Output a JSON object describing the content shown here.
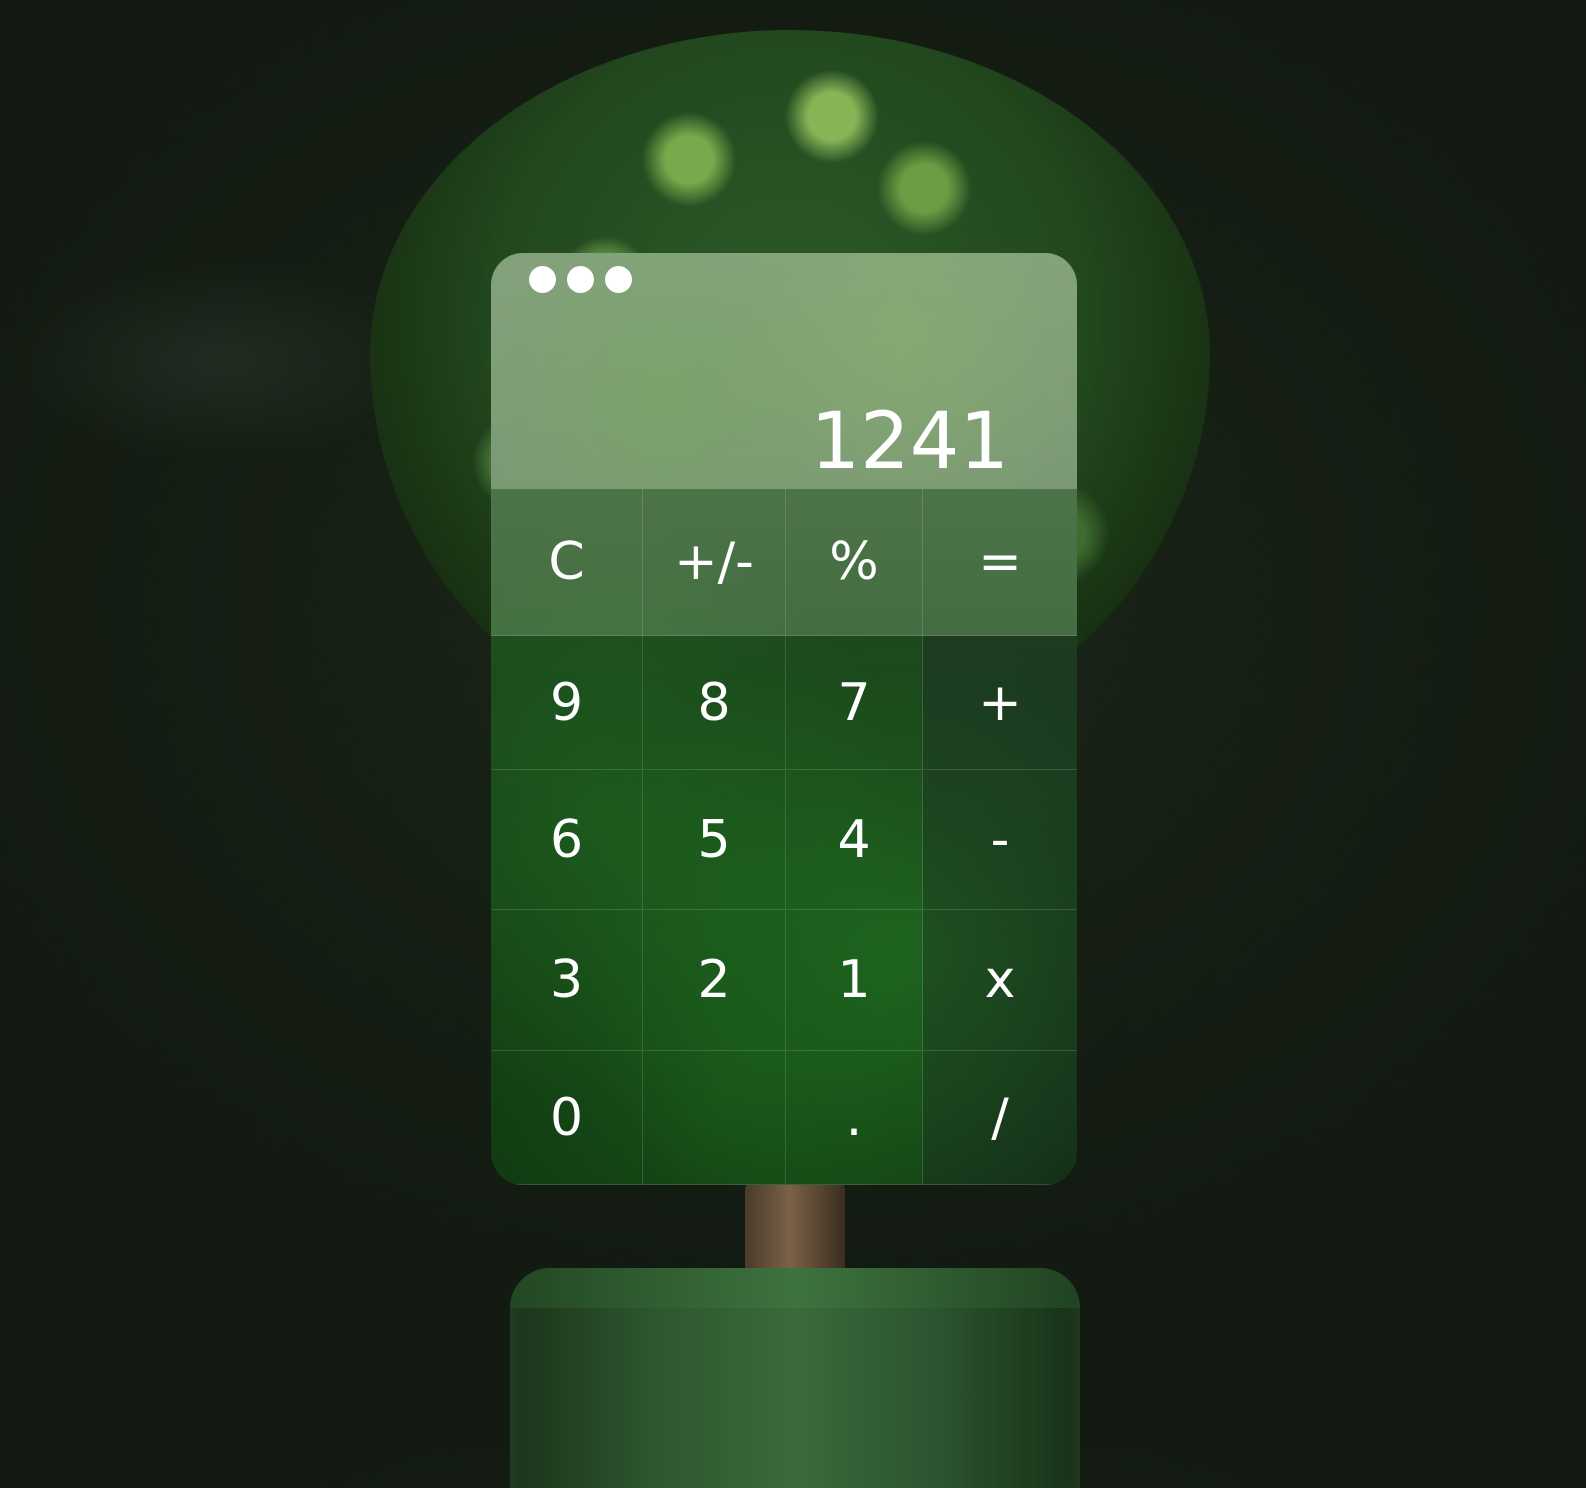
{
  "window": {
    "dots": [
      "window-dot-1",
      "window-dot-2",
      "window-dot-3"
    ]
  },
  "display": {
    "value": "1241"
  },
  "keypad": {
    "rows": [
      [
        {
          "label": "C",
          "kind": "fn"
        },
        {
          "label": "+/-",
          "kind": "fn"
        },
        {
          "label": "%",
          "kind": "fn"
        },
        {
          "label": "=",
          "kind": "fn"
        }
      ],
      [
        {
          "label": "9",
          "kind": "num"
        },
        {
          "label": "8",
          "kind": "num"
        },
        {
          "label": "7",
          "kind": "num"
        },
        {
          "label": "+",
          "kind": "op"
        }
      ],
      [
        {
          "label": "6",
          "kind": "num"
        },
        {
          "label": "5",
          "kind": "num"
        },
        {
          "label": "4",
          "kind": "num"
        },
        {
          "label": "-",
          "kind": "op"
        }
      ],
      [
        {
          "label": "3",
          "kind": "num"
        },
        {
          "label": "2",
          "kind": "num"
        },
        {
          "label": "1",
          "kind": "num"
        },
        {
          "label": "x",
          "kind": "op"
        }
      ],
      [
        {
          "label": "0",
          "kind": "num"
        },
        {
          "label": "",
          "kind": "num"
        },
        {
          "label": ".",
          "kind": "num"
        },
        {
          "label": "/",
          "kind": "op"
        }
      ]
    ]
  }
}
